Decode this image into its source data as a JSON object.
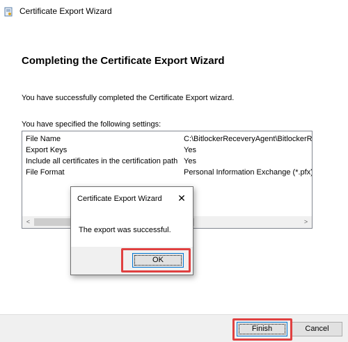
{
  "window": {
    "title": "Certificate Export Wizard"
  },
  "main": {
    "heading": "Completing the Certificate Export Wizard",
    "success_text": "You have successfully completed the Certificate Export wizard.",
    "settings_label": "You have specified the following settings:",
    "settings": [
      {
        "key": "File Name",
        "value": "C:\\BitlockerReceveryAgent\\BitlockerRe"
      },
      {
        "key": "Export Keys",
        "value": "Yes"
      },
      {
        "key": "Include all certificates in the certification path",
        "value": "Yes"
      },
      {
        "key": "File Format",
        "value": "Personal Information Exchange (*.pfx)"
      }
    ],
    "scroll_left_glyph": "<",
    "scroll_right_glyph": ">"
  },
  "footer": {
    "finish_label": "Finish",
    "cancel_label": "Cancel"
  },
  "dialog": {
    "title": "Certificate Export Wizard",
    "close_glyph": "✕",
    "message": "The export was successful.",
    "ok_label": "OK"
  },
  "colors": {
    "highlight": "#e04040",
    "accent": "#0078d7"
  }
}
